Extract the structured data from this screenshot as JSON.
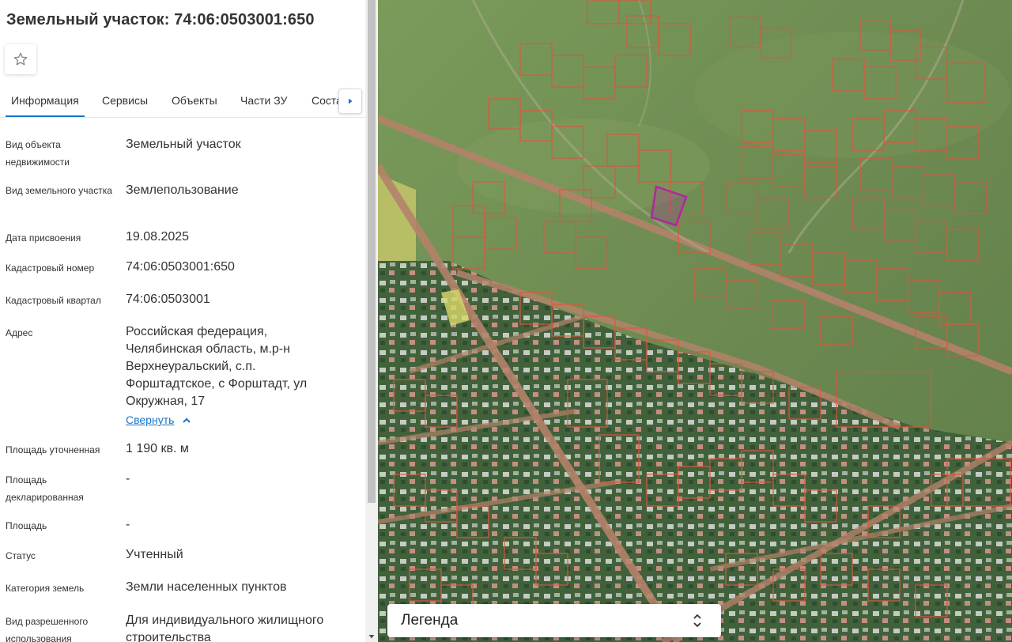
{
  "panel": {
    "title": "Земельный участок: 74:06:0503001:650",
    "favorite_icon": "star-outline-icon",
    "tabs": [
      {
        "label": "Информация",
        "active": true
      },
      {
        "label": "Сервисы",
        "active": false
      },
      {
        "label": "Объекты",
        "active": false
      },
      {
        "label": "Части ЗУ",
        "active": false
      },
      {
        "label": "Соста",
        "active": false
      }
    ],
    "tab_next_icon": "chevron-right-icon",
    "fields": [
      {
        "label": "Вид объекта недвижимости",
        "value": "Земельный участок"
      },
      {
        "label": "Вид земельного участка",
        "value": "Землепользование"
      },
      {
        "label": "Дата присвоения",
        "value": "19.08.2025"
      },
      {
        "label": "Кадастровый номер",
        "value": "74:06:0503001:650"
      },
      {
        "label": "Кадастровый квартал",
        "value": "74:06:0503001"
      },
      {
        "label": "Адрес",
        "value": "Российская федерация, Челябинская область, м.р-н Верхнеуральский, с.п. Форштадтское, с Форштадт, ул Окружная, 17"
      },
      {
        "label": "Площадь уточненная",
        "value": "1 190 кв. м"
      },
      {
        "label": "Площадь декларированная",
        "value": "-"
      },
      {
        "label": "Площадь",
        "value": "-"
      },
      {
        "label": "Статус",
        "value": "Учтенный"
      },
      {
        "label": "Категория земель",
        "value": "Земли населенных пунктов"
      },
      {
        "label": "Вид разрешенного использования",
        "value": "Для индивидуального жилищного строительства"
      }
    ],
    "collapse_link": "Свернуть",
    "collapse_icon": "chevron-up-icon"
  },
  "map": {
    "legend_label": "Легенда",
    "legend_toggle_icon": "unfold-icon",
    "colors": {
      "parcel_outline": "#d9583f",
      "selected_parcel": "#b0279e",
      "road": "#b4826a",
      "field": "#6f8c52"
    }
  }
}
